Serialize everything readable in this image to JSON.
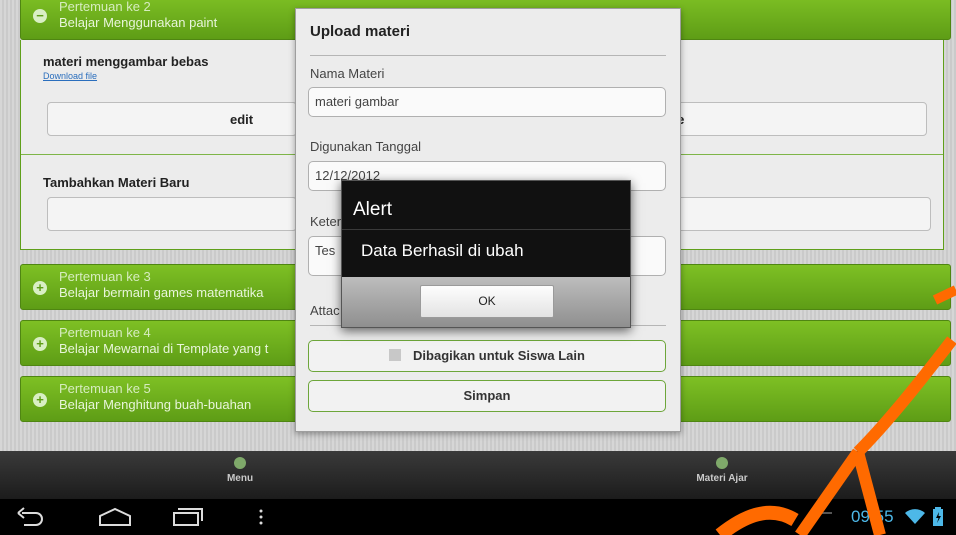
{
  "meetings": [
    {
      "number": "Pertemuan ke 2",
      "topic": "Belajar Menggunakan paint"
    },
    {
      "number": "Pertemuan ke 3",
      "topic": "Belajar bermain games matematika"
    },
    {
      "number": "Pertemuan ke 4",
      "topic": "Belajar Mewarnai di Template yang t"
    },
    {
      "number": "Pertemuan ke 5",
      "topic": "Belajar Menghitung buah-buahan"
    }
  ],
  "material": {
    "name": "materi menggambar bebas",
    "download_label": "Download file",
    "edit_label": "edit",
    "delete_label": "lete"
  },
  "add_material": {
    "title": "Tambahkan Materi Baru"
  },
  "upload_dialog": {
    "title": "Upload materi",
    "name_label": "Nama Materi",
    "name_value": "materi gambar",
    "date_label": "Digunakan Tanggal",
    "date_value": "12/12/2012",
    "desc_label": "Keter",
    "desc_value": "Tes",
    "attach_label": "Attac",
    "share_label": "Dibagikan untuk Siswa Lain",
    "save_label": "Simpan"
  },
  "alert": {
    "title": "Alert",
    "message": "Data Berhasil di ubah",
    "ok_label": "OK"
  },
  "bottom_menu": {
    "menu_label": "Menu",
    "materi_label": "Materi Ajar"
  },
  "status_bar": {
    "time": "09:55"
  },
  "colors": {
    "accent_green": "#6aaa1e",
    "alert_bg": "#111111",
    "watermark": "#ff6a00"
  }
}
